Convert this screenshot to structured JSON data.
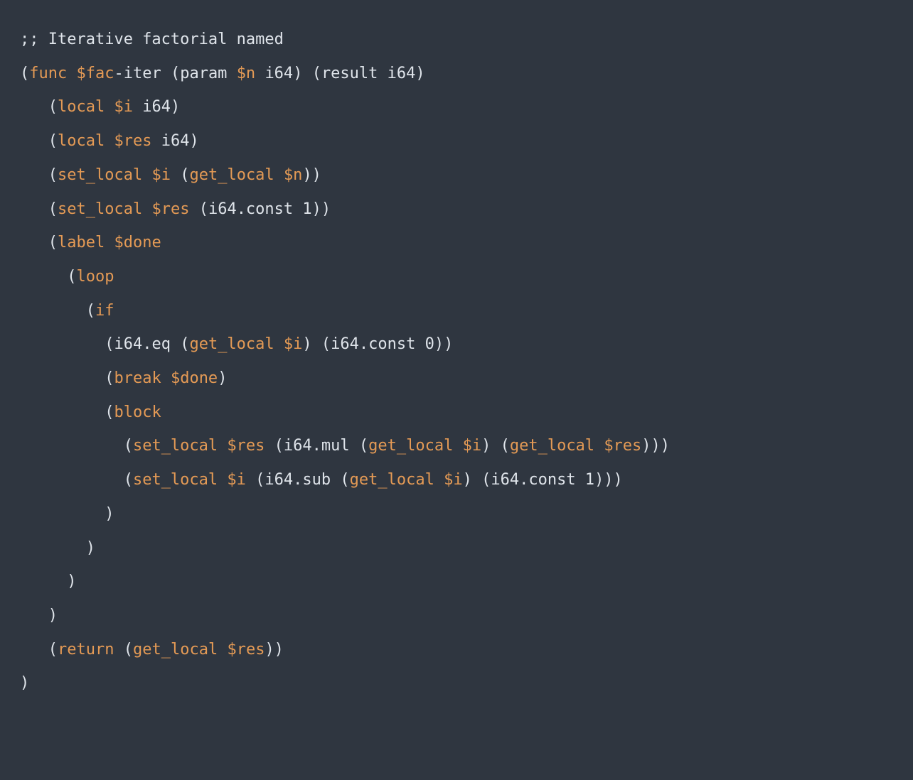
{
  "code": {
    "comment": ";; Iterative factorial named",
    "kw": {
      "func": "func",
      "local": "local",
      "set_local": "set_local",
      "get_local": "get_local",
      "label": "label",
      "loop": "loop",
      "if": "if",
      "break": "break",
      "block": "block",
      "return": "return",
      "param": "param",
      "result": "result"
    },
    "var": {
      "fac": "$fac",
      "n": "$n",
      "i": "$i",
      "res": "$res",
      "done": "$done"
    },
    "t": {
      "iter": "-iter",
      "i64": "i64",
      "i64_const_1": "i64.const 1",
      "i64_const_0": "i64.const 0",
      "i64_eq": "i64.eq",
      "i64_mul": "i64.mul",
      "i64_sub": "i64.sub",
      "lp": "(",
      "rp": ")",
      "sp": " ",
      "rp2": "))",
      "rp3": ")))",
      "ind1": "   ",
      "ind2": "     ",
      "ind3": "       ",
      "ind4": "         ",
      "ind5": "           "
    }
  }
}
